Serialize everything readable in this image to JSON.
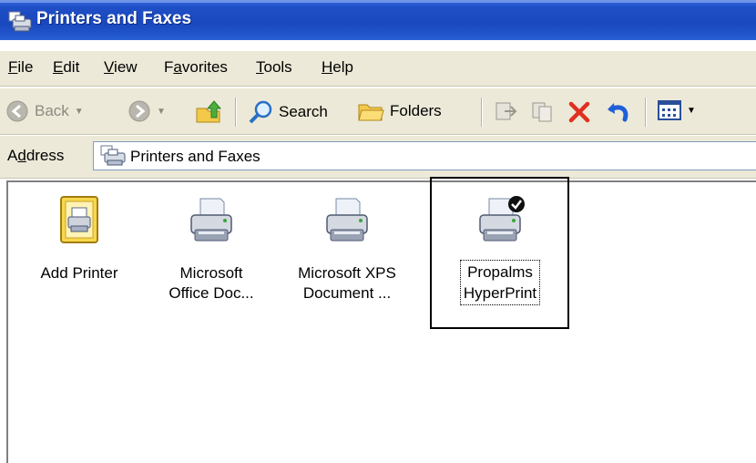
{
  "window": {
    "title": "Printers and Faxes"
  },
  "menu": [
    {
      "label": "File",
      "key": "F",
      "rest": "ile"
    },
    {
      "label": "Edit",
      "key": "E",
      "rest": "dit"
    },
    {
      "label": "View",
      "key": "V",
      "rest": "iew"
    },
    {
      "label": "Favorites",
      "pre": "F",
      "key": "a",
      "rest": "vorites"
    },
    {
      "label": "Tools",
      "key": "T",
      "rest": "ools"
    },
    {
      "label": "Help",
      "key": "H",
      "rest": "elp"
    }
  ],
  "toolbar": {
    "back_label": "Back",
    "search_label": "Search",
    "folders_label": "Folders"
  },
  "address": {
    "label_pre": "A",
    "label_key": "d",
    "label_rest": "dress",
    "value": "Printers and Faxes"
  },
  "items": [
    {
      "line1": "Add Printer",
      "line2": ""
    },
    {
      "line1": "Microsoft",
      "line2": "Office Doc..."
    },
    {
      "line1": "Microsoft XPS",
      "line2": "Document ..."
    },
    {
      "line1": "Propalms",
      "line2": "HyperPrint",
      "selected": true,
      "default": true
    }
  ],
  "colors": {
    "titlebar": "#1f4fc6",
    "chrome": "#ece9d8",
    "delete_red": "#e03020"
  }
}
